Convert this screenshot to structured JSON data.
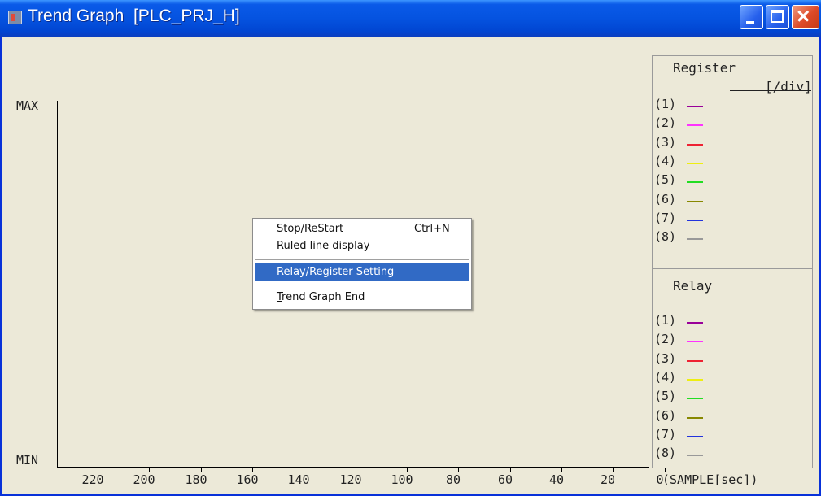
{
  "window": {
    "title": "Trend Graph  [PLC_PRJ_H]"
  },
  "graph": {
    "y_max_label": "MAX",
    "y_min_label": "MIN",
    "x_ticks": [
      "220",
      "200",
      "180",
      "160",
      "140",
      "120",
      "100",
      "80",
      "60",
      "40",
      "20",
      "0"
    ],
    "x_unit": "(SAMPLE[sec])"
  },
  "register_panel": {
    "title": "Register",
    "unit": "[/div]",
    "items": [
      {
        "label": "(1)",
        "color": "#990099"
      },
      {
        "label": "(2)",
        "color": "#ff33ff"
      },
      {
        "label": "(3)",
        "color": "#ee2233"
      },
      {
        "label": "(4)",
        "color": "#eeee11"
      },
      {
        "label": "(5)",
        "color": "#22dd22"
      },
      {
        "label": "(6)",
        "color": "#888800"
      },
      {
        "label": "(7)",
        "color": "#2233dd"
      },
      {
        "label": "(8)",
        "color": "#999999"
      }
    ]
  },
  "relay_panel": {
    "title": "Relay",
    "items": [
      {
        "label": "(1)",
        "color": "#990099"
      },
      {
        "label": "(2)",
        "color": "#ff33ff"
      },
      {
        "label": "(3)",
        "color": "#ee2233"
      },
      {
        "label": "(4)",
        "color": "#eeee11"
      },
      {
        "label": "(5)",
        "color": "#22dd22"
      },
      {
        "label": "(6)",
        "color": "#888800"
      },
      {
        "label": "(7)",
        "color": "#2233dd"
      },
      {
        "label": "(8)",
        "color": "#999999"
      }
    ]
  },
  "context_menu": {
    "items": [
      {
        "label": "Stop/ReStart",
        "shortcut": "Ctrl+N",
        "mnemonic": "S",
        "selected": false
      },
      {
        "label": "Ruled line display",
        "mnemonic": "R",
        "selected": false
      },
      {
        "label": "Relay/Register Setting",
        "mnemonic": "e",
        "selected": true
      },
      {
        "label": "Trend Graph End",
        "mnemonic": "T",
        "selected": false
      }
    ]
  }
}
